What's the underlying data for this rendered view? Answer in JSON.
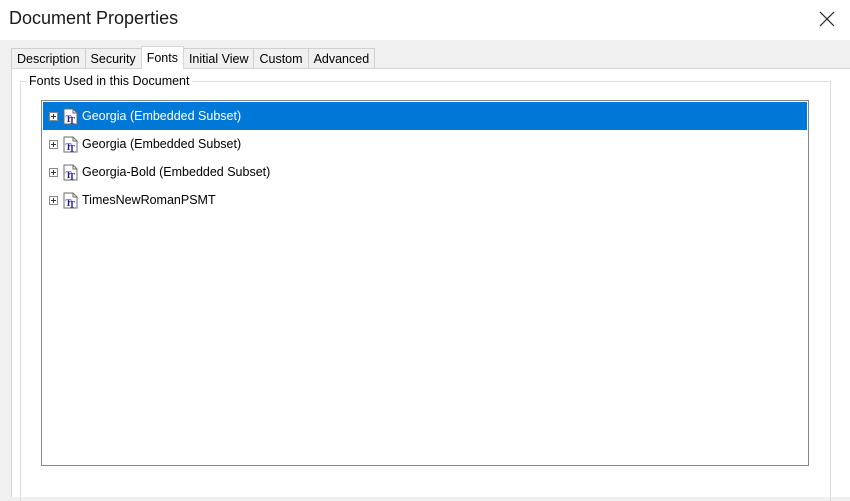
{
  "window": {
    "title": "Document Properties"
  },
  "tabs": [
    {
      "label": "Description",
      "active": false
    },
    {
      "label": "Security",
      "active": false
    },
    {
      "label": "Fonts",
      "active": true
    },
    {
      "label": "Initial View",
      "active": false
    },
    {
      "label": "Custom",
      "active": false
    },
    {
      "label": "Advanced",
      "active": false
    }
  ],
  "fonts_panel": {
    "group_label": "Fonts Used in this Document",
    "fonts": [
      {
        "label": "Georgia (Embedded Subset)",
        "selected": true,
        "icon": "truetype-font-icon"
      },
      {
        "label": "Georgia (Embedded Subset)",
        "selected": false,
        "icon": "truetype-font-icon"
      },
      {
        "label": "Georgia-Bold (Embedded Subset)",
        "selected": false,
        "icon": "truetype-font-icon"
      },
      {
        "label": "TimesNewRomanPSMT",
        "selected": false,
        "icon": "truetype-font-icon"
      }
    ]
  },
  "colors": {
    "selection": "#0078d7",
    "window_bg": "#f0f0f0"
  }
}
